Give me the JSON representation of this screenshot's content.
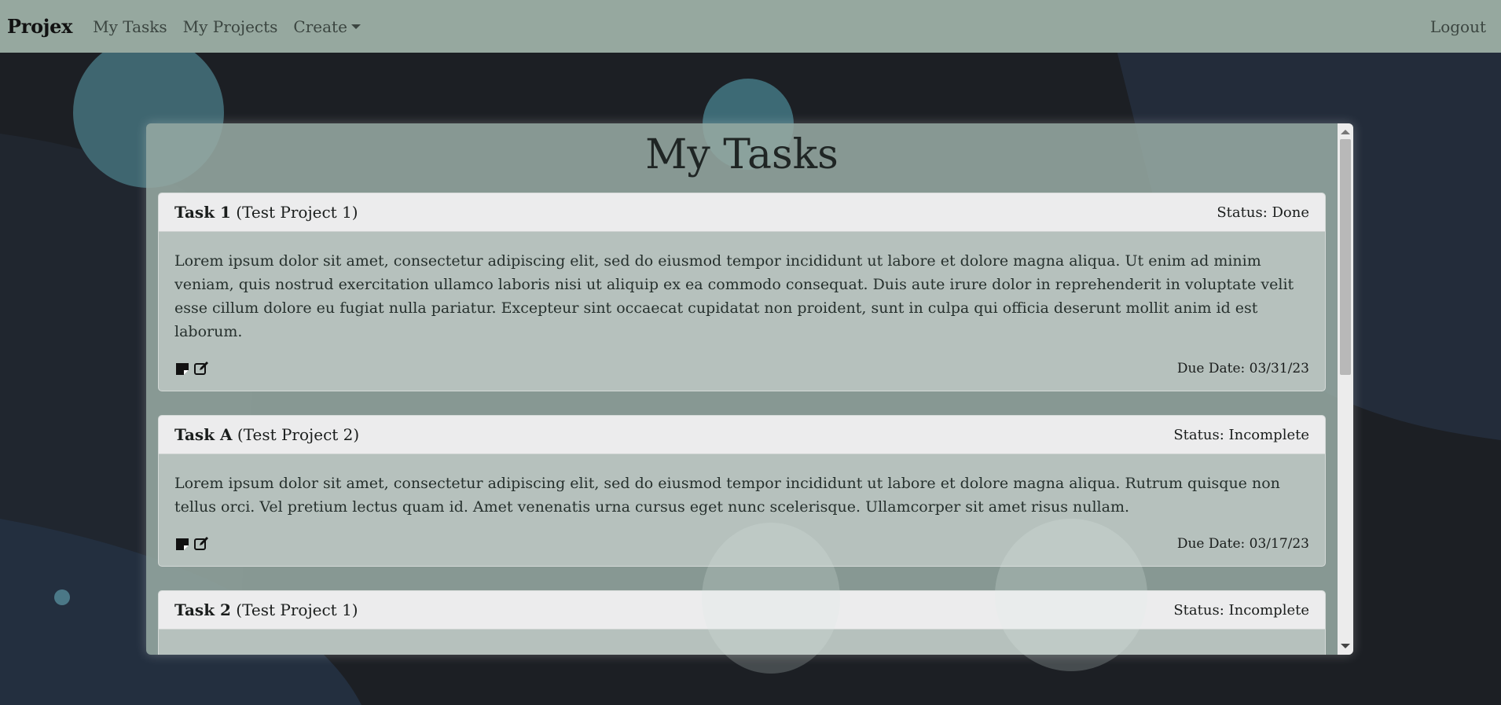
{
  "navbar": {
    "brand": "Projex",
    "links": [
      "My Tasks",
      "My Projects"
    ],
    "create_label": "Create",
    "logout_label": "Logout"
  },
  "page": {
    "title": "My Tasks"
  },
  "tasks": [
    {
      "name": "Task 1",
      "project": "(Test Project 1)",
      "status": "Status: Done",
      "description": "Lorem ipsum dolor sit amet, consectetur adipiscing elit, sed do eiusmod tempor incididunt ut labore et dolore magna aliqua. Ut enim ad minim veniam, quis nostrud exercitation ullamco laboris nisi ut aliquip ex ea commodo consequat. Duis aute irure dolor in reprehenderit in voluptate velit esse cillum dolore eu fugiat nulla pariatur. Excepteur sint occaecat cupidatat non proident, sunt in culpa qui officia deserunt mollit anim id est laborum.",
      "due": "Due Date: 03/31/23"
    },
    {
      "name": "Task A",
      "project": "(Test Project 2)",
      "status": "Status: Incomplete",
      "description": "Lorem ipsum dolor sit amet, consectetur adipiscing elit, sed do eiusmod tempor incididunt ut labore et dolore magna aliqua. Rutrum quisque non tellus orci. Vel pretium lectus quam id. Amet venenatis urna cursus eget nunc scelerisque. Ullamcorper sit amet risus nullam.",
      "due": "Due Date: 03/17/23"
    },
    {
      "name": "Task 2",
      "project": "(Test Project 1)",
      "status": "Status: Incomplete",
      "description": "",
      "due": ""
    }
  ],
  "icons": {
    "note": "sticky-note-icon",
    "edit": "edit-icon"
  }
}
